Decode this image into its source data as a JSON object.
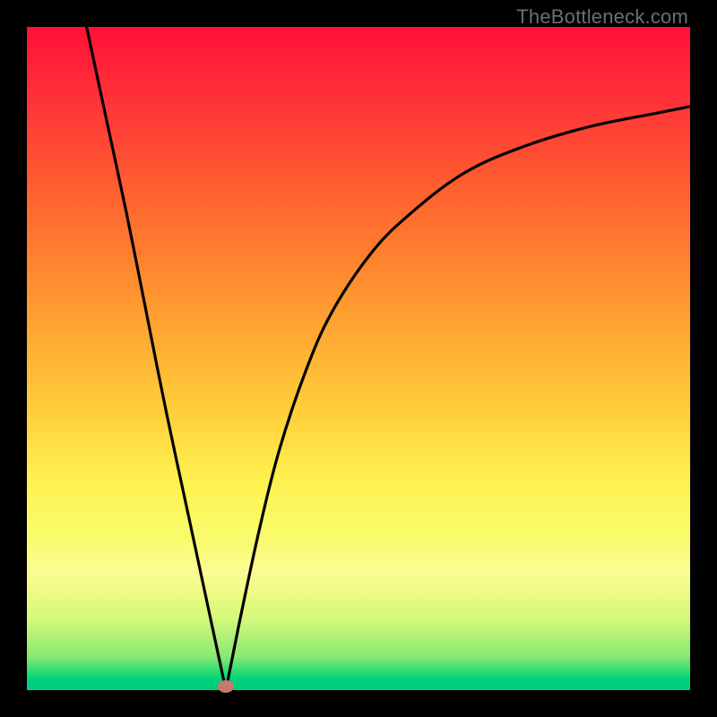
{
  "watermark": "TheBottleneck.com",
  "chart_data": {
    "type": "line",
    "title": "",
    "xlabel": "",
    "ylabel": "",
    "xlim": [
      0,
      100
    ],
    "ylim": [
      0,
      100
    ],
    "grid": false,
    "legend": false,
    "minimum_marker": {
      "x": 30,
      "y": 0,
      "color": "#c47b6f"
    },
    "background_gradient": [
      "#ff1034",
      "#ff5730",
      "#ffce3a",
      "#fafb69",
      "#1ddb74"
    ],
    "series": [
      {
        "name": "bottleneck-curve",
        "color": "#000000",
        "points": [
          {
            "x": 9,
            "y": 100
          },
          {
            "x": 12,
            "y": 86
          },
          {
            "x": 15,
            "y": 72
          },
          {
            "x": 18,
            "y": 57
          },
          {
            "x": 21,
            "y": 42
          },
          {
            "x": 24,
            "y": 28
          },
          {
            "x": 27,
            "y": 14
          },
          {
            "x": 30,
            "y": 0
          },
          {
            "x": 32,
            "y": 10
          },
          {
            "x": 35,
            "y": 24
          },
          {
            "x": 38,
            "y": 36
          },
          {
            "x": 42,
            "y": 48
          },
          {
            "x": 46,
            "y": 57
          },
          {
            "x": 52,
            "y": 66
          },
          {
            "x": 58,
            "y": 72
          },
          {
            "x": 66,
            "y": 78
          },
          {
            "x": 75,
            "y": 82
          },
          {
            "x": 85,
            "y": 85
          },
          {
            "x": 95,
            "y": 87
          },
          {
            "x": 100,
            "y": 88
          }
        ]
      }
    ]
  }
}
